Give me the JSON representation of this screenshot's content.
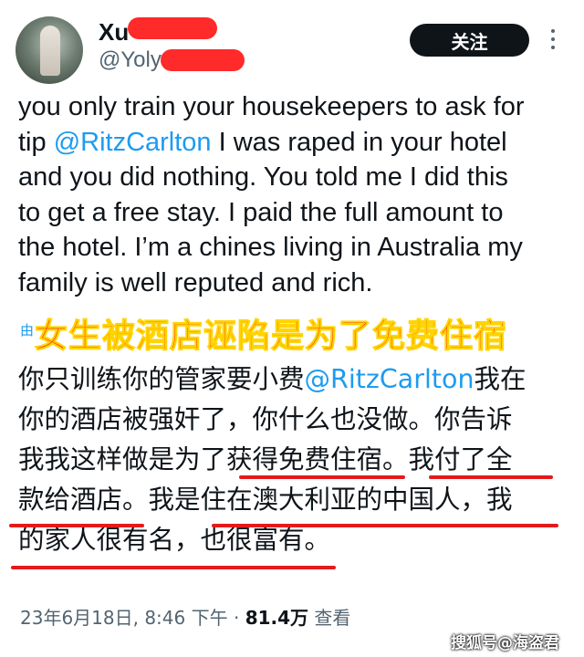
{
  "author": {
    "name_visible": "Xu",
    "handle_visible": "@Yoly"
  },
  "follow_button": {
    "label": "关注"
  },
  "tweet": {
    "lines": [
      "you only train your housekeepers to ask for",
      "tip ",
      "@RitzCarlton",
      " I was raped in your hotel",
      "and you did nothing. You told me I did this",
      "to get a free stay. I paid the full amount to",
      "the hotel. I’m a chines living in Australia my",
      "family is well reputed and rich."
    ],
    "translated_by": "由"
  },
  "banner_text": "女生被酒店诬陷是为了免费住宿",
  "translation": {
    "line1_a": "你只训练你的管家要小费",
    "line1_mention": "@RitzCarlton",
    "line1_b": "我在",
    "line2": "你的酒店被强奸了，你什么也没做。你告诉",
    "line3": "我我这样做是为了获得免费住宿。我付了全",
    "line4": "款给酒店。我是住在澳大利亚的中国人，我",
    "line5": "的家人很有名，也很富有。"
  },
  "meta": {
    "date_time": "23年6月18日, 8:46 下午 · ",
    "views_count": "81.4万",
    "views_label": " 查看"
  },
  "watermark": "搜狐号@海盗君",
  "colors": {
    "mention": "#1d9bf0",
    "redaction": "#ff2a2a",
    "banner_fill": "#ff1a1a",
    "banner_outline": "#ffd400",
    "underline": "#e31b1b"
  }
}
